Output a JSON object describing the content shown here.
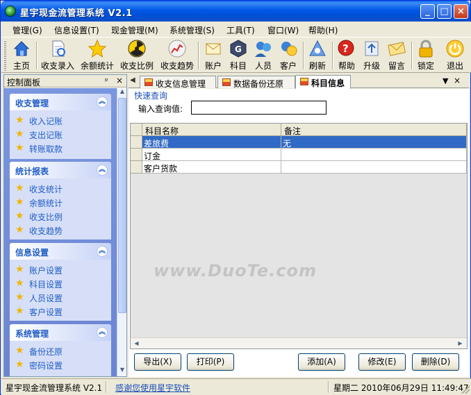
{
  "window": {
    "title": "星宇现金流管理系统 V2.1",
    "controls": {
      "minimize": "_",
      "maximize": "□",
      "close": "×"
    }
  },
  "menu": [
    "管理(G)",
    "信息设置(T)",
    "现金管理(M)",
    "系统管理(S)",
    "工具(T)",
    "窗口(W)",
    "帮助(H)"
  ],
  "toolbar": {
    "items": [
      {
        "label": "主页",
        "icon": "home-icon"
      },
      {
        "label": "收支录入",
        "icon": "document-icon"
      },
      {
        "label": "余额统计",
        "icon": "star-icon"
      },
      {
        "label": "收支比例",
        "icon": "radiation-icon"
      },
      {
        "label": "收支趋势",
        "icon": "chart-icon"
      },
      {
        "label": "账户",
        "icon": "account-icon"
      },
      {
        "label": "科目",
        "icon": "category-icon"
      },
      {
        "label": "人员",
        "icon": "people-icon"
      },
      {
        "label": "客户",
        "icon": "customer-icon"
      },
      {
        "label": "刷新",
        "icon": "refresh-icon"
      },
      {
        "label": "帮助",
        "icon": "help-icon"
      },
      {
        "label": "升级",
        "icon": "upgrade-icon"
      },
      {
        "label": "留言",
        "icon": "message-icon"
      },
      {
        "label": "锁定",
        "icon": "lock-icon"
      },
      {
        "label": "退出",
        "icon": "exit-icon"
      }
    ]
  },
  "sidebar": {
    "title": "控制面板",
    "pin": "ᵖ",
    "close": "×",
    "groups": [
      {
        "title": "收支管理",
        "items": [
          "收入记账",
          "支出记账",
          "转账取款"
        ]
      },
      {
        "title": "统计报表",
        "items": [
          "收支统计",
          "余额统计",
          "收支比例",
          "收支趋势"
        ]
      },
      {
        "title": "信息设置",
        "items": [
          "账户设置",
          "科目设置",
          "人员设置",
          "客户设置"
        ]
      },
      {
        "title": "系统管理",
        "items": [
          "备份还原",
          "密码设置"
        ]
      }
    ]
  },
  "tabs": {
    "items": [
      {
        "label": "收支信息管理",
        "active": false
      },
      {
        "label": "数据备份还原",
        "active": false
      },
      {
        "label": "科目信息",
        "active": true
      }
    ],
    "dropdown": "▼",
    "close": "×"
  },
  "quick_search": {
    "title": "快速查询",
    "label": "输入查询值:",
    "value": ""
  },
  "table": {
    "columns": [
      "科目名称",
      "备注"
    ],
    "rows": [
      {
        "name": "差旅费",
        "note": "无",
        "selected": true
      },
      {
        "name": "订金",
        "note": "",
        "selected": false
      },
      {
        "name": "客户货款",
        "note": "",
        "selected": false
      }
    ]
  },
  "buttons": {
    "export": "导出(X)",
    "print": "打印(P)",
    "add": "添加(A)",
    "edit": "修改(E)",
    "delete": "删除(D)"
  },
  "watermark": "www.DuoTe.com",
  "status": {
    "app": "星宇现金流管理系统 V2.1",
    "message": "感谢您使用星宇软件",
    "datetime": "星期二 2010年06月29日 11:49:47"
  }
}
